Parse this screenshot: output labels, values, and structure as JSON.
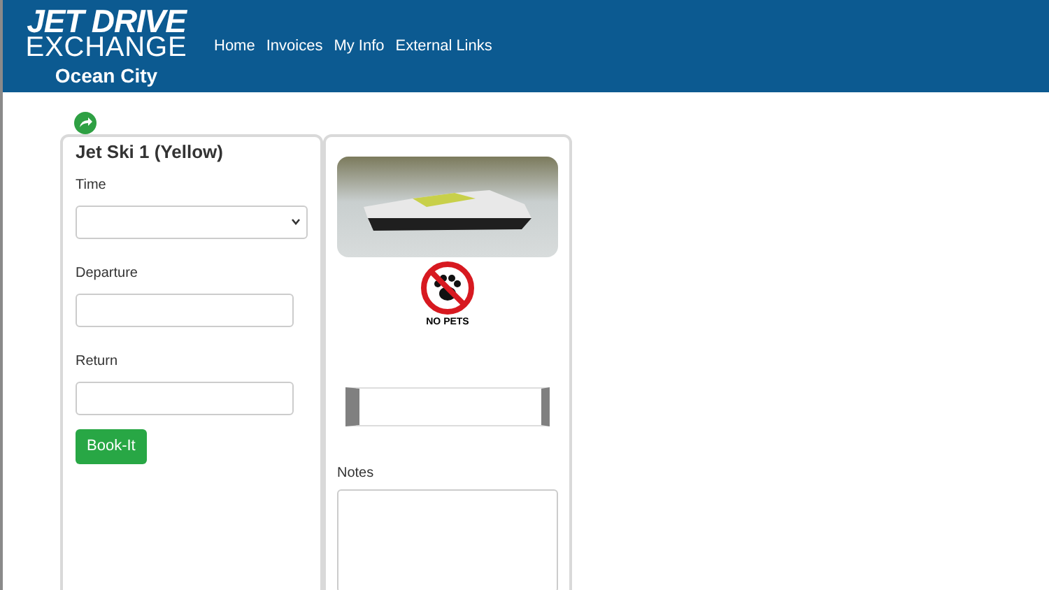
{
  "brand": {
    "line_1": "JET DRIVE",
    "line_2": "EXCHANGE",
    "location": "Ocean City"
  },
  "nav": [
    "Home",
    "Invoices",
    "My Info",
    "External Links"
  ],
  "booking": {
    "title": "Jet Ski 1 (Yellow)",
    "fields": [
      {
        "label": "Time",
        "kind": "select"
      },
      {
        "label": "Departure",
        "kind": "text"
      },
      {
        "label": "Return",
        "kind": "text"
      }
    ],
    "button": "Book-It"
  },
  "details": {
    "sign_caption": "NO PETS",
    "notes_label": "Notes"
  }
}
